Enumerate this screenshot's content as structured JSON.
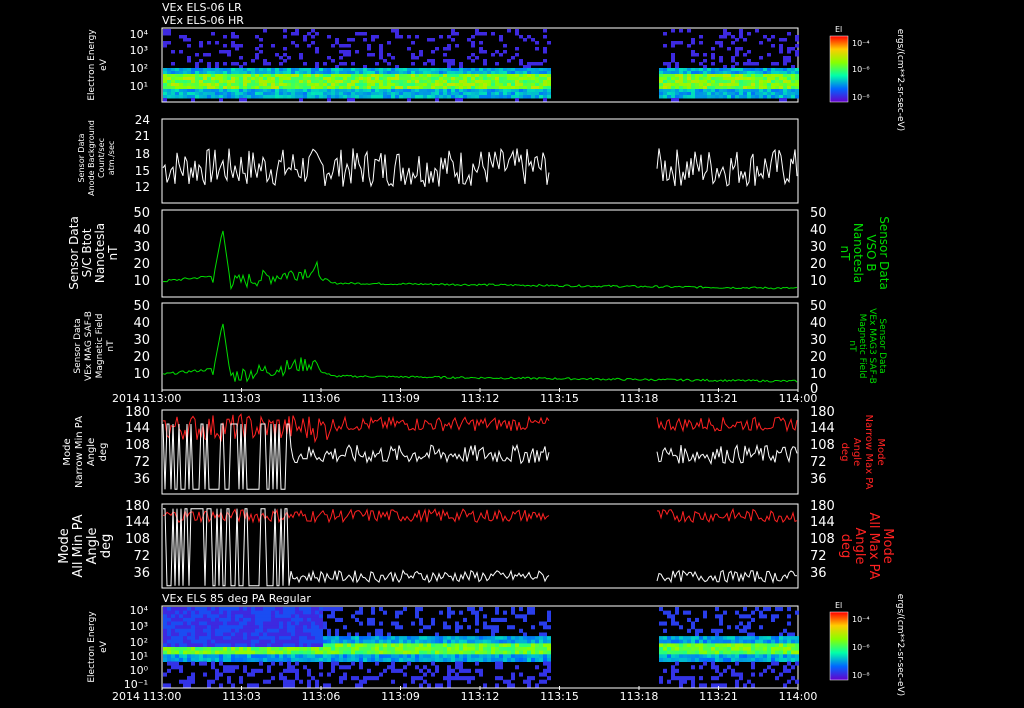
{
  "header": {
    "line1": "VEx ELS-06 LR",
    "line2": "VEx ELS-06 HR"
  },
  "colors": {
    "green": "#00dd00",
    "red": "#ff2222",
    "white": "#ffffff"
  },
  "time_axis": {
    "ticks": [
      "113:00",
      "113:03",
      "113:06",
      "113:09",
      "113:12",
      "113:15",
      "113:18",
      "113:21",
      "114:00"
    ],
    "year": "2014"
  },
  "chart_data": [
    {
      "type": "heatmap",
      "ylabel": [
        "Electron Energy",
        "eV"
      ],
      "y_ticks": [
        "10⁴",
        "10³",
        "10²",
        "10¹"
      ],
      "colorbar": {
        "title": "El",
        "ticks": [
          "10⁻⁴",
          "10⁻⁶",
          "10⁻⁸"
        ]
      },
      "right_label": "ergs/(cm**2-sr-sec-eV)",
      "data_gap": [
        "113:14.6",
        "113:18.5"
      ]
    },
    {
      "type": "line",
      "ylabel": [
        "Sensor Data",
        "Anode Background",
        "Count/sec",
        "atm./sec"
      ],
      "y_ticks": [
        "24",
        "21",
        "18",
        "15",
        "12"
      ],
      "ylim": [
        11,
        24
      ],
      "series": [
        {
          "color": "white",
          "mean": 16.5,
          "spread": 3
        }
      ],
      "data_gap": [
        "113:14.6",
        "113:18.5"
      ]
    },
    {
      "type": "line",
      "ylabel": [
        "Sensor Data",
        "S/C Btot",
        "Nanotesla",
        "nT"
      ],
      "right_label": [
        "Sensor Data",
        "VSO B",
        "Nanotesla",
        "nT"
      ],
      "y_ticks": [
        "50",
        "40",
        "30",
        "20",
        "10"
      ],
      "right_ticks": [
        "50",
        "40",
        "30",
        "20",
        "10"
      ],
      "ylim": [
        0,
        50
      ],
      "series": [
        {
          "color": "green",
          "peak": 40,
          "baseline": 8
        }
      ]
    },
    {
      "type": "line",
      "ylabel": [
        "Sensor Data",
        "VEx MAG SAF-B",
        "Magnetic Field",
        "nT"
      ],
      "right_label": [
        "Sensor Data",
        "VEx MAG3 SAF-B",
        "Magnetic Field",
        "nT"
      ],
      "y_ticks": [
        "50",
        "40",
        "30",
        "20",
        "10"
      ],
      "right_ticks": [
        "50",
        "40",
        "30",
        "20",
        "10",
        "0"
      ],
      "ylim": [
        0,
        50
      ],
      "series": [
        {
          "color": "green",
          "peak": 40,
          "baseline": 8
        }
      ]
    },
    {
      "type": "line",
      "ylabel": [
        "Mode",
        "Narrow Min PA",
        "Angle",
        "deg"
      ],
      "right_label": [
        "Mode",
        "Narrow Max PA",
        "Angle",
        "deg"
      ],
      "y_ticks": [
        "180",
        "144",
        "108",
        "72",
        "36"
      ],
      "right_ticks": [
        "180",
        "144",
        "108",
        "72",
        "36"
      ],
      "ylim": [
        0,
        180
      ],
      "series": [
        {
          "color": "red",
          "mean": 150
        },
        {
          "color": "white",
          "mean": 85
        }
      ],
      "data_gap": [
        "113:14.6",
        "113:18.5"
      ]
    },
    {
      "type": "line",
      "ylabel": [
        "Mode",
        "All Min PA",
        "Angle",
        "deg"
      ],
      "right_label": [
        "Mode",
        "All Max PA",
        "Angle",
        "deg"
      ],
      "y_ticks": [
        "180",
        "144",
        "108",
        "72",
        "36"
      ],
      "right_ticks": [
        "180",
        "144",
        "108",
        "72",
        "36"
      ],
      "ylim": [
        0,
        180
      ],
      "series": [
        {
          "color": "red",
          "mean": 155
        },
        {
          "color": "white",
          "mean": 25
        }
      ],
      "data_gap": [
        "113:14.6",
        "113:18.5"
      ]
    },
    {
      "type": "heatmap",
      "title": "VEx ELS 85 deg PA Regular",
      "ylabel": [
        "Electron Energy",
        "eV"
      ],
      "y_ticks": [
        "10⁴",
        "10³",
        "10²",
        "10¹",
        "10⁰",
        "10⁻¹"
      ],
      "colorbar": {
        "title": "El",
        "ticks": [
          "10⁻⁴",
          "10⁻⁶",
          "10⁻⁸"
        ]
      },
      "right_label": "ergs/(cm**2-sr-sec-eV)",
      "data_gap": [
        "113:14.6",
        "113:18.5"
      ]
    }
  ]
}
